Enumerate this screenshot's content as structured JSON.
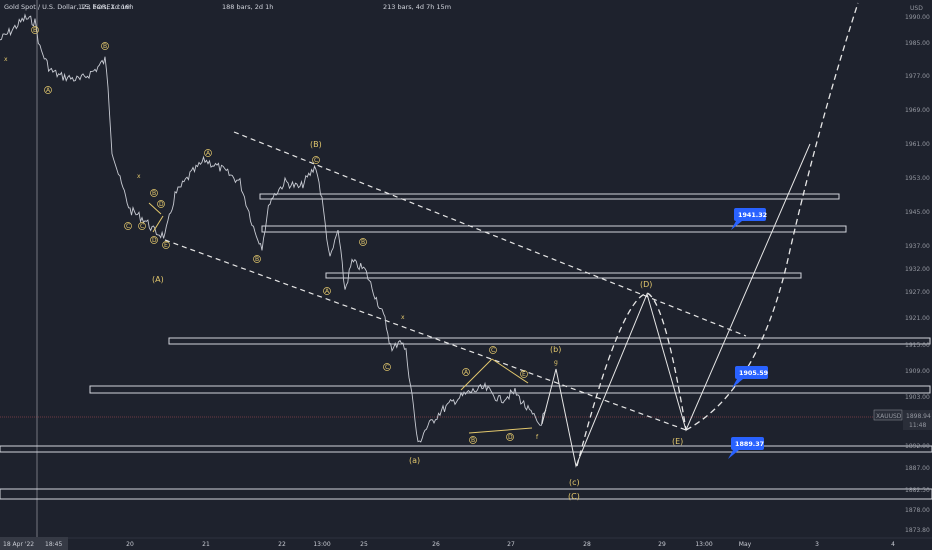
{
  "header": {
    "symbol_title": "Gold Spot / U.S. Dollar, 15, FOREX.com",
    "range_bars_1": "123 bars, 1d 16h",
    "range_bars_2": "188 bars, 2d 1h",
    "range_bars_3": "213 bars, 4d 7h 15m"
  },
  "price_axis": {
    "currency": "USD",
    "ticks": [
      "1990.00",
      "1985.00",
      "1977.00",
      "1969.00",
      "1961.00",
      "1953.00",
      "1945.00",
      "1937.00",
      "1932.00",
      "1927.00",
      "1921.00",
      "1915.00",
      "1909.00",
      "1903.00",
      "1897.00",
      "1892.00",
      "1887.00",
      "1882.50",
      "1878.00",
      "1873.80"
    ],
    "symbol_tag": "XAUUSD",
    "current_price": "1898.94",
    "countdown": "11:48"
  },
  "time_axis": {
    "start_date": "18 Apr '22",
    "start_time": "18:45",
    "ticks": [
      "20",
      "21",
      "22",
      "13:00",
      "25",
      "26",
      "27",
      "28",
      "29",
      "13:00",
      "May",
      "3",
      "4"
    ]
  },
  "price_labels": [
    "1941.32",
    "1905.59",
    "1889.37"
  ],
  "wave_labels": {
    "big": [
      "(A)",
      "(B)",
      "(D)",
      "(E)",
      "(C)",
      "(a)",
      "(b)",
      "(c)"
    ],
    "small": [
      "A",
      "B",
      "C",
      "D",
      "E",
      "x",
      "c",
      "g",
      "f"
    ]
  },
  "colors": {
    "background": "#1e222d",
    "price": "#c8cbd3",
    "wave_label": "#e3c86d",
    "label_box": "#2962ff",
    "zones": "#d1d4dc"
  },
  "chart_data": {
    "type": "line",
    "title": "Gold Spot / U.S. Dollar, 15, FOREX.com",
    "xlabel": "",
    "ylabel": "USD",
    "ylim": [
      1873.8,
      1993
    ],
    "x_ticks": [
      "20",
      "21",
      "22",
      "13:00",
      "25",
      "26",
      "27",
      "28",
      "29",
      "13:00",
      "May",
      "3",
      "4"
    ],
    "price_series": [
      {
        "t": "18 Apr",
        "y": 1985
      },
      {
        "t": "19 Apr",
        "y": 1975
      },
      {
        "t": "19 Apr",
        "y": 1978
      },
      {
        "t": "19 Apr",
        "y": 1955
      },
      {
        "t": "20 Apr",
        "y": 1942
      },
      {
        "t": "20 Apr",
        "y": 1952
      },
      {
        "t": "21 Apr",
        "y": 1957
      },
      {
        "t": "21 Apr",
        "y": 1950
      },
      {
        "t": "21 Apr",
        "y": 1938
      },
      {
        "t": "22 Apr",
        "y": 1952
      },
      {
        "t": "22 Apr 13:00",
        "y": 1956
      },
      {
        "t": "22 Apr",
        "y": 1941
      },
      {
        "t": "25 Apr",
        "y": 1930
      },
      {
        "t": "25 Apr",
        "y": 1919
      },
      {
        "t": "25 Apr",
        "y": 1895
      },
      {
        "t": "26 Apr",
        "y": 1903
      },
      {
        "t": "26 Apr",
        "y": 1910
      },
      {
        "t": "27 Apr",
        "y": 1898
      },
      {
        "t": "27 Apr",
        "y": 1899
      }
    ],
    "projection": [
      {
        "t": "27 Apr",
        "y": 1909
      },
      {
        "t": "28 Apr",
        "y": 1887
      },
      {
        "t": "29 Apr",
        "y": 1928
      },
      {
        "t": "29 Apr",
        "y": 1895
      },
      {
        "t": "May",
        "y": 1960
      }
    ],
    "levels": [
      1952,
      1943,
      1931,
      1916,
      1905,
      1893,
      1884
    ],
    "price_labels": [
      1941.32,
      1905.59,
      1889.37
    ],
    "current_price": 1898.94
  }
}
